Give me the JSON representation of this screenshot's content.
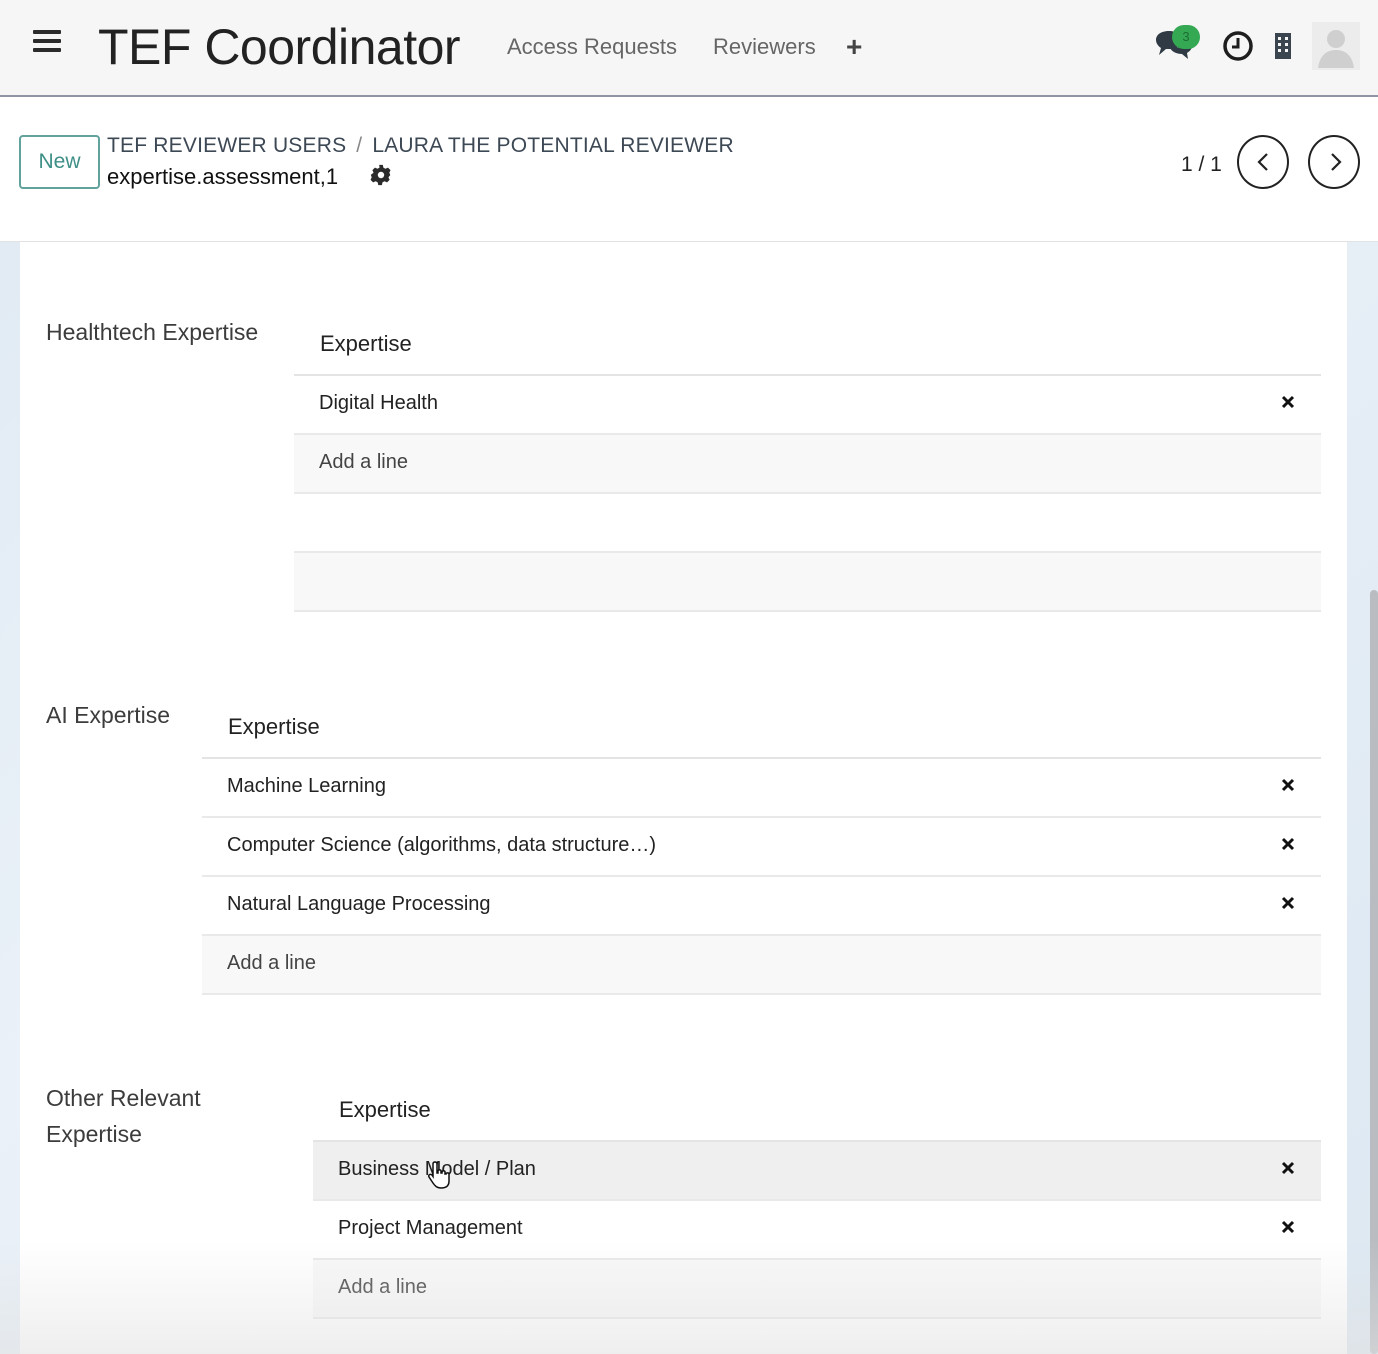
{
  "navbar": {
    "app_title": "TEF Coordinator",
    "menu": [
      "Access Requests",
      "Reviewers"
    ],
    "add_symbol": "+",
    "chat_badge_count": "3"
  },
  "control_panel": {
    "new_button": "New",
    "breadcrumb": [
      "TEF REVIEWER USERS",
      "LAURA THE POTENTIAL REVIEWER"
    ],
    "breadcrumb_separator": "/",
    "record_name": "expertise.assessment,1",
    "pager": "1 / 1"
  },
  "sections": {
    "healthtech": {
      "label": "Healthtech Expertise",
      "column_header": "Expertise",
      "rows": [
        "Digital Health"
      ],
      "add_line": "Add a line"
    },
    "ai": {
      "label": "AI Expertise",
      "column_header": "Expertise",
      "rows": [
        "Machine Learning",
        "Computer Science (algorithms, data structure…)",
        "Natural Language Processing"
      ],
      "add_line": "Add a line"
    },
    "other": {
      "label_line1": "Other Relevant",
      "label_line2": "Expertise",
      "column_header": "Expertise",
      "rows": [
        "Business Model / Plan",
        "Project Management"
      ],
      "add_line": "Add a line"
    }
  },
  "colors": {
    "accent": "#3e8f87",
    "badge": "#34a853"
  }
}
